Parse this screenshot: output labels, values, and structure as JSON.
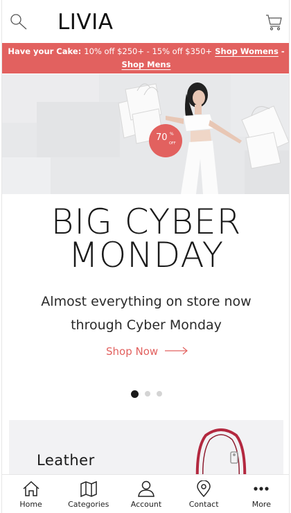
{
  "header": {
    "brand": "LIVIA",
    "search_icon": "search-icon",
    "cart_icon": "cart-icon"
  },
  "promo": {
    "lead": "Have your Cake:",
    "offer": "10% off $250+ - 15% off $350+",
    "separator": "-",
    "link_womens": "Shop Womens",
    "link_mens": "Shop Mens",
    "background": "#e2615f"
  },
  "hero": {
    "badge_number": "70",
    "badge_percent": "%",
    "badge_off": "OFF",
    "badge_color": "#e2615f"
  },
  "main": {
    "headline_line1": "BIG CYBER",
    "headline_line2": "MONDAY",
    "subtext": "Almost everything on store now through Cyber Monday",
    "cta_label": "Shop Now",
    "cta_color": "#e2615f",
    "carousel": {
      "count": 3,
      "active": 0
    }
  },
  "card": {
    "title": "Leather"
  },
  "bottom_nav": {
    "items": [
      {
        "label": "Home",
        "icon": "home-icon"
      },
      {
        "label": "Categories",
        "icon": "map-icon"
      },
      {
        "label": "Account",
        "icon": "user-icon"
      },
      {
        "label": "Contact",
        "icon": "location-pin-icon"
      },
      {
        "label": "More",
        "icon": "more-dots-icon"
      }
    ]
  }
}
